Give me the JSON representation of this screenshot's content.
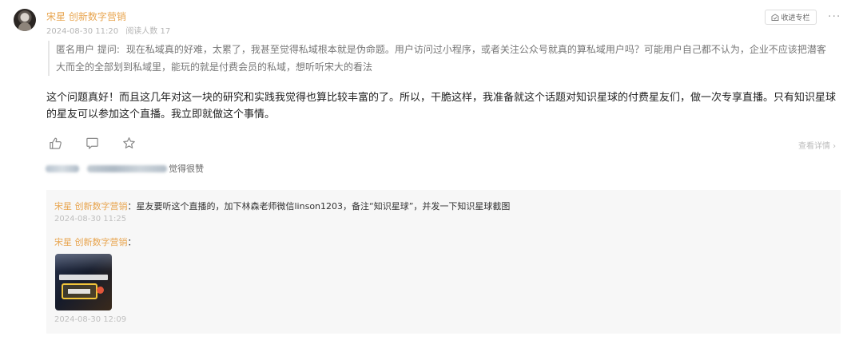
{
  "post": {
    "author": "宋星 创新数字营销",
    "date": "2024-08-30 11:20",
    "readers": "阅读人数 17",
    "collect_label": "收进专栏",
    "more_label": "···",
    "question": {
      "asker": "匿名用户  提问:",
      "text": "现在私域真的好难，太累了，我甚至觉得私域根本就是伪命题。用户访问过小程序，或者关注公众号就真的算私域用户吗？可能用户自己都不认为，企业不应该把潜客大而全的全部划到私域里，能玩的就是付费会员的私域，想听听宋大的看法"
    },
    "answer": "这个问题真好！而且这几年对这一块的研究和实践我觉得也算比较丰富的了。所以，干脆这样，我准备就这个话题对知识星球的付费星友们，做一次专享直播。只有知识星球的星友可以参加这个直播。我立即就做这个事情。",
    "actions": {
      "like_icon": "thumb-up-icon",
      "comment_icon": "comment-icon",
      "star_icon": "star-icon"
    },
    "detail_label": "查看详情 ›",
    "likes_suffix": "觉得很赞"
  },
  "comments": [
    {
      "author": "宋星 创新数字营销",
      "separator": "：",
      "text": "星友要听这个直播的，加下林森老师微信linson1203，备注“知识星球”，并发一下知识星球截图",
      "time": "2024-08-30 11:25"
    },
    {
      "author": "宋星 创新数字营销",
      "separator": "：",
      "image_icon": "image-thumbnail",
      "time": "2024-08-30 12:09"
    }
  ],
  "colors": {
    "author": "#e8a54f",
    "muted": "#b5b5b5",
    "comment_bg": "#f7f7f7"
  }
}
